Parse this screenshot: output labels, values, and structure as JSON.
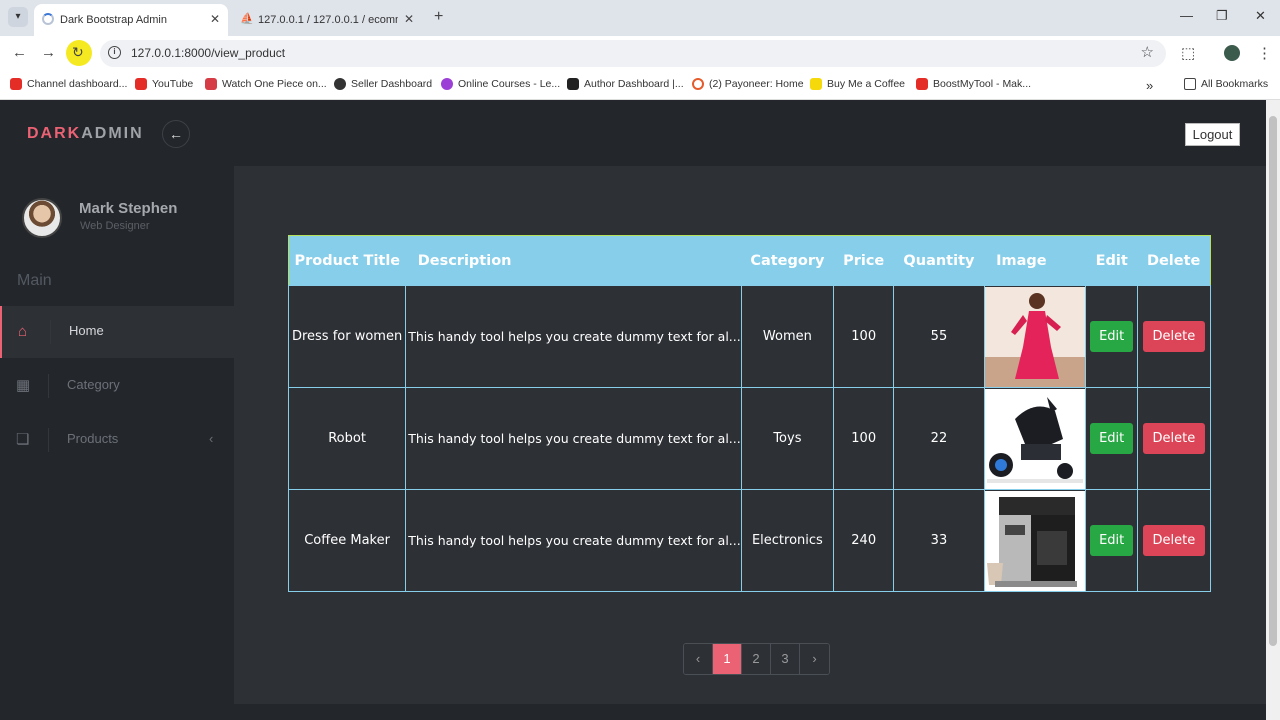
{
  "browser": {
    "tabs": [
      {
        "title": "Dark Bootstrap Admin",
        "active": true
      },
      {
        "title": "127.0.0.1 / 127.0.0.1 / ecomme",
        "active": false
      }
    ],
    "url": "127.0.0.1:8000/view_product",
    "bookmarks": [
      "Channel dashboard...",
      "YouTube",
      "Watch One Piece on...",
      "Seller Dashboard",
      "Online Courses - Le...",
      "Author Dashboard |...",
      "(2) Payoneer: Home",
      "Buy Me a Coffee",
      "BoostMyTool - Mak..."
    ],
    "all_bookmarks": "All Bookmarks"
  },
  "app": {
    "brand_part1": "DARK",
    "brand_part2": "ADMIN",
    "logout": "Logout",
    "user": {
      "name": "Mark Stephen",
      "role": "Web Designer"
    },
    "section": "Main",
    "nav": [
      {
        "label": "Home",
        "icon": "home-icon",
        "active": true
      },
      {
        "label": "Category",
        "icon": "grid-icon",
        "active": false
      },
      {
        "label": "Products",
        "icon": "window-icon",
        "active": false
      }
    ],
    "accent": "#eb6274"
  },
  "table": {
    "headers": [
      "Product Title",
      "Description",
      "Category",
      "Price",
      "Quantity",
      "Image",
      "Edit",
      "Delete"
    ],
    "rows": [
      {
        "title": "Dress for women",
        "description": "This handy tool helps you create dummy text for al...",
        "category": "Women",
        "price": "100",
        "quantity": "55",
        "image": "dress-image",
        "edit": "Edit",
        "delete": "Delete"
      },
      {
        "title": "Robot",
        "description": "This handy tool helps you create dummy text for al...",
        "category": "Toys",
        "price": "100",
        "quantity": "22",
        "image": "robot-image",
        "edit": "Edit",
        "delete": "Delete"
      },
      {
        "title": "Coffee Maker",
        "description": "This handy tool helps you create dummy text for al...",
        "category": "Electronics",
        "price": "240",
        "quantity": "33",
        "image": "coffee-maker-image",
        "edit": "Edit",
        "delete": "Delete"
      }
    ]
  },
  "pagination": {
    "prev": "‹",
    "pages": [
      "1",
      "2",
      "3"
    ],
    "next": "›",
    "current": "1"
  }
}
